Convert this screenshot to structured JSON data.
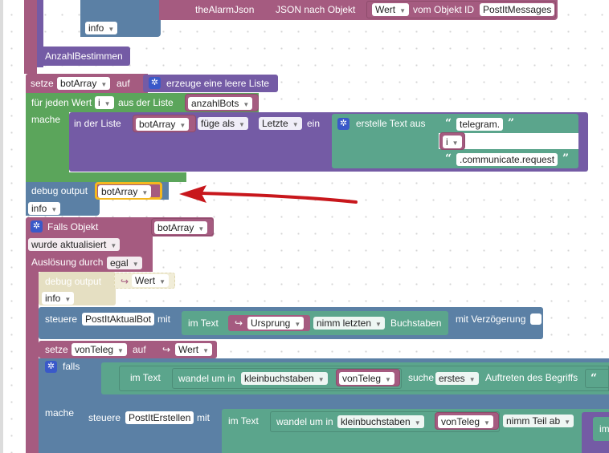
{
  "colors": {
    "variables": "#a55b80",
    "lists": "#745ba5",
    "loops": "#5ba55b",
    "text": "#5ba58c",
    "objects": "#a55b80",
    "debug": "#5b80a5",
    "event": "#a55b80",
    "control": "#5b80a5",
    "highlight": "#f5b81e",
    "arrow": "#c8171c"
  },
  "top": {
    "alarm_json": "theAlarmJson",
    "json_nach_objekt": "JSON nach Objekt",
    "wert": "Wert",
    "vom_objekt_id": "vom Objekt ID",
    "postit_messages": "PostItMessages",
    "info": "info",
    "anzahl_bestimmen": "AnzahlBestimmen"
  },
  "setze1": {
    "setze": "setze",
    "var": "botArray",
    "auf": "auf",
    "erzeuge": "erzeuge eine leere Liste"
  },
  "loop": {
    "fuer_jeden_wert": "für jeden Wert",
    "var_i": "i",
    "aus_der_liste": "aus der Liste",
    "anzahl_bots": "anzahlBots",
    "mache": "mache",
    "in_der_liste": "in der Liste",
    "bot_array": "botArray",
    "fuege_als": "füge als",
    "letzte": "Letzte",
    "ein": "ein",
    "erstelle_text_aus": "erstelle Text aus",
    "telegram": "telegram.",
    "i": "i",
    "communicate": ".communicate.request"
  },
  "debug1": {
    "label": "debug output",
    "var": "botArray",
    "info": "info"
  },
  "falls_objekt": {
    "label": "Falls Objekt",
    "var": "botArray",
    "wurde_aktualisiert": "wurde aktualisiert",
    "ausloesung_durch": "Auslösung durch",
    "egal": "egal"
  },
  "debug2": {
    "label": "debug output",
    "wert": "Wert",
    "info": "info"
  },
  "steuere1": {
    "steuere": "steuere",
    "target": "PostItAktualBot",
    "mit": "mit",
    "im_text": "im Text",
    "ursprung": "Ursprung",
    "nimm_letzten": "nimm letzten",
    "buchstaben": "Buchstaben",
    "mit_verzoegerung": "mit Verzögerung"
  },
  "setze2": {
    "setze": "setze",
    "var": "vonTeleg",
    "auf": "auf",
    "wert": "Wert"
  },
  "falls": {
    "label": "falls",
    "im_text": "im Text",
    "wandel_um_in": "wandel um in",
    "kleinbuchstaben": "kleinbuchstaben",
    "von_teleg": "vonTeleg",
    "suche": "suche",
    "erstes": "erstes",
    "auftreten": "Auftreten des Begriffs"
  },
  "mache2": {
    "mache": "mache",
    "steuere": "steuere",
    "target": "PostItErstellen",
    "mit": "mit",
    "im_text": "im Text",
    "wandel_um_in": "wandel um in",
    "kleinbuchstaben": "kleinbuchstaben",
    "von_teleg": "vonTeleg",
    "nimm_teil_ab": "nimm Teil ab",
    "im_cut": "im"
  }
}
